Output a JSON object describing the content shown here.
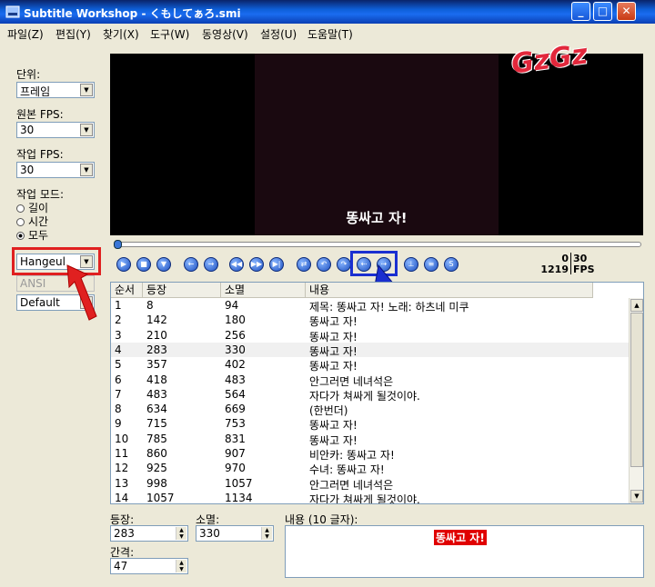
{
  "window": {
    "title": "Subtitle Workshop - くもしてぁろ.smi"
  },
  "menu": [
    "파일(Z)",
    "편집(Y)",
    "찾기(X)",
    "도구(W)",
    "동영상(V)",
    "설정(U)",
    "도움말(T)"
  ],
  "left": {
    "unit_label": "단위:",
    "unit_value": "프레임",
    "src_fps_label": "원본 FPS:",
    "src_fps_value": "30",
    "work_fps_label": "작업 FPS:",
    "work_fps_value": "30",
    "mode_label": "작업 모드:",
    "modes": [
      {
        "label": "길이",
        "checked": false
      },
      {
        "label": "시간",
        "checked": false
      },
      {
        "label": "모두",
        "checked": true
      }
    ],
    "charset_value": "Hangeul",
    "encoding_value": "ANSI",
    "style_value": "Default"
  },
  "video": {
    "subtitle": "똥싸고 자!",
    "watermark": "GzGz"
  },
  "stats": {
    "line1_left": "0",
    "line1_right": "30",
    "line2_left": "1219",
    "line2_right": "FPS"
  },
  "table": {
    "headers": [
      "순서",
      "등장",
      "소멸",
      "내용"
    ],
    "rows": [
      [
        "1",
        "8",
        "94",
        "제목: 똥싸고 자! 노래: 하츠네 미쿠"
      ],
      [
        "2",
        "142",
        "180",
        "똥싸고 자!"
      ],
      [
        "3",
        "210",
        "256",
        "똥싸고 자!"
      ],
      [
        "4",
        "283",
        "330",
        "똥싸고 자!"
      ],
      [
        "5",
        "357",
        "402",
        "똥싸고 자!"
      ],
      [
        "6",
        "418",
        "483",
        "안그러면 네녀석은"
      ],
      [
        "7",
        "483",
        "564",
        "자다가 쳐싸게 될것이야."
      ],
      [
        "8",
        "634",
        "669",
        "(한번더)"
      ],
      [
        "9",
        "715",
        "753",
        "똥싸고 자!"
      ],
      [
        "10",
        "785",
        "831",
        "똥싸고 자!"
      ],
      [
        "11",
        "860",
        "907",
        "비안카: 똥싸고 자!"
      ],
      [
        "12",
        "925",
        "970",
        "수녀: 똥싸고 자!"
      ],
      [
        "13",
        "998",
        "1057",
        "안그러면 네녀석은"
      ],
      [
        "14",
        "1057",
        "1134",
        "자다가 쳐싸게 될것이야."
      ]
    ]
  },
  "editor": {
    "start_label": "등장:",
    "start_value": "283",
    "end_label": "소멸:",
    "end_value": "330",
    "dur_label": "간격:",
    "dur_value": "47",
    "text_label": "내용 (10 글자):",
    "text_value": "똥싸고 자!"
  }
}
